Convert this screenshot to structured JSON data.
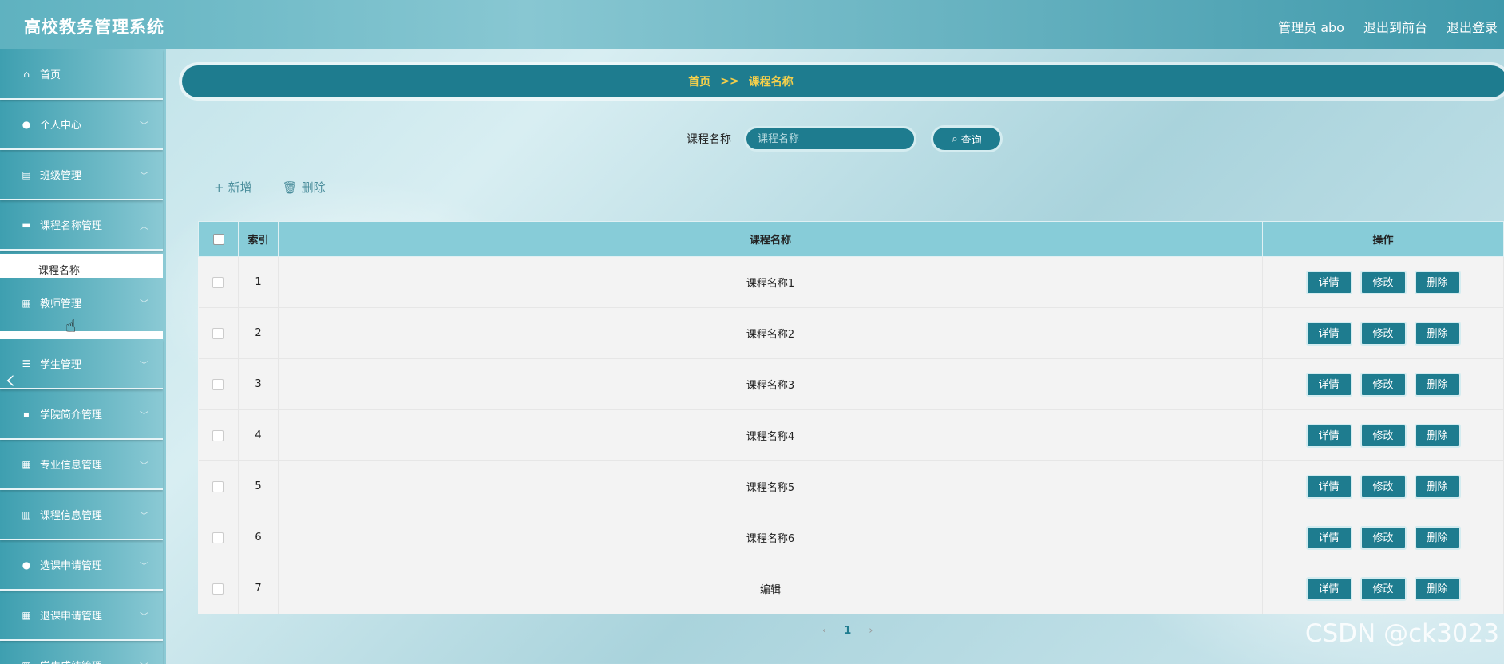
{
  "app": {
    "title": "高校教务管理系统",
    "user_label": "管理员 abo",
    "back_to_front": "退出到前台",
    "logout": "退出登录"
  },
  "sidebar": {
    "items": [
      {
        "label": "首页",
        "icon": "home-icon"
      },
      {
        "label": "个人中心",
        "icon": "user-icon"
      },
      {
        "label": "班级管理",
        "icon": "clipboard-icon"
      },
      {
        "label": "课程名称管理",
        "icon": "print-icon"
      },
      {
        "label": "教师管理",
        "icon": "grid-icon"
      },
      {
        "label": "学生管理",
        "icon": "sliders-icon"
      },
      {
        "label": "学院简介管理",
        "icon": "chat-icon"
      },
      {
        "label": "专业信息管理",
        "icon": "grid-icon"
      },
      {
        "label": "课程信息管理",
        "icon": "library-icon"
      },
      {
        "label": "选课申请管理",
        "icon": "user-icon"
      },
      {
        "label": "退课申请管理",
        "icon": "grid-icon"
      },
      {
        "label": "学生成绩管理",
        "icon": "grid-icon"
      }
    ],
    "submenu": {
      "label": "课程名称"
    }
  },
  "breadcrumb": {
    "home": "首页",
    "sep": ">>",
    "current": "课程名称"
  },
  "search": {
    "label": "课程名称",
    "placeholder": "课程名称",
    "button": "查询"
  },
  "actions": {
    "add": "新增",
    "delete": "删除"
  },
  "table": {
    "headers": {
      "index": "索引",
      "name": "课程名称",
      "ops": "操作"
    },
    "rows": [
      {
        "index": "1",
        "name": "课程名称1"
      },
      {
        "index": "2",
        "name": "课程名称2"
      },
      {
        "index": "3",
        "name": "课程名称3"
      },
      {
        "index": "4",
        "name": "课程名称4"
      },
      {
        "index": "5",
        "name": "课程名称5"
      },
      {
        "index": "6",
        "name": "课程名称6"
      },
      {
        "index": "7",
        "name": "编辑"
      }
    ],
    "op_labels": {
      "detail": "详情",
      "edit": "修改",
      "delete": "删除"
    }
  },
  "pagination": {
    "prev": "‹",
    "current": "1",
    "next": "›"
  },
  "watermark": "CSDN @ck3023",
  "colors": {
    "primary": "#1e7c8f",
    "header_row": "#87ccd8",
    "breadcrumb_text": "#f7d04a"
  }
}
